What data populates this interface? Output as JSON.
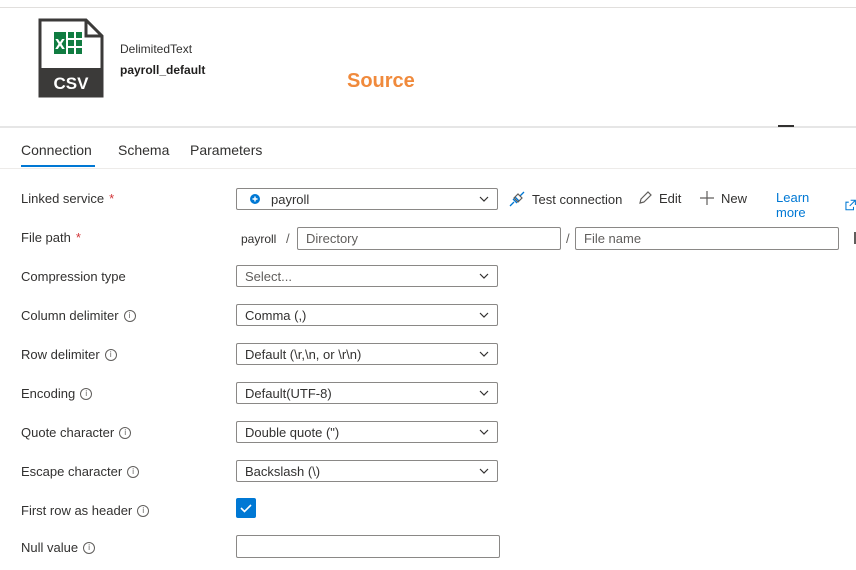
{
  "dataset": {
    "type_label": "DelimitedText",
    "name": "payroll_default",
    "icon_text": "CSV",
    "panel_title": "Source"
  },
  "tabs": [
    {
      "label": "Connection",
      "active": true
    },
    {
      "label": "Schema",
      "active": false
    },
    {
      "label": "Parameters",
      "active": false
    }
  ],
  "linked_service": {
    "label": "Linked service",
    "required_mark": "*",
    "value": "payroll",
    "icon": "linked-service-icon",
    "actions": {
      "test_connection": "Test connection",
      "edit": "Edit",
      "new": "New",
      "learn_more": "Learn more"
    }
  },
  "file_path": {
    "label": "File path",
    "required_mark": "*",
    "container": "payroll",
    "separator": "/",
    "directory_placeholder": "Directory",
    "file_placeholder": "File name"
  },
  "compression_type": {
    "label": "Compression type",
    "value": "Select..."
  },
  "column_delimiter": {
    "label": "Column delimiter",
    "value": "Comma (,)"
  },
  "row_delimiter": {
    "label": "Row delimiter",
    "value": "Default (\\r,\\n, or \\r\\n)"
  },
  "encoding": {
    "label": "Encoding",
    "value": "Default(UTF-8)"
  },
  "quote_character": {
    "label": "Quote character",
    "value": "Double quote (\")"
  },
  "escape_character": {
    "label": "Escape character",
    "value": "Backslash (\\)"
  },
  "first_row_header": {
    "label": "First row as header",
    "checked": true
  },
  "null_value": {
    "label": "Null value",
    "value": ""
  },
  "info_glyph": "i",
  "colors": {
    "accent": "#0078d4",
    "title": "#f08a3c",
    "excel_green": "#107c41",
    "required": "#d13438"
  }
}
